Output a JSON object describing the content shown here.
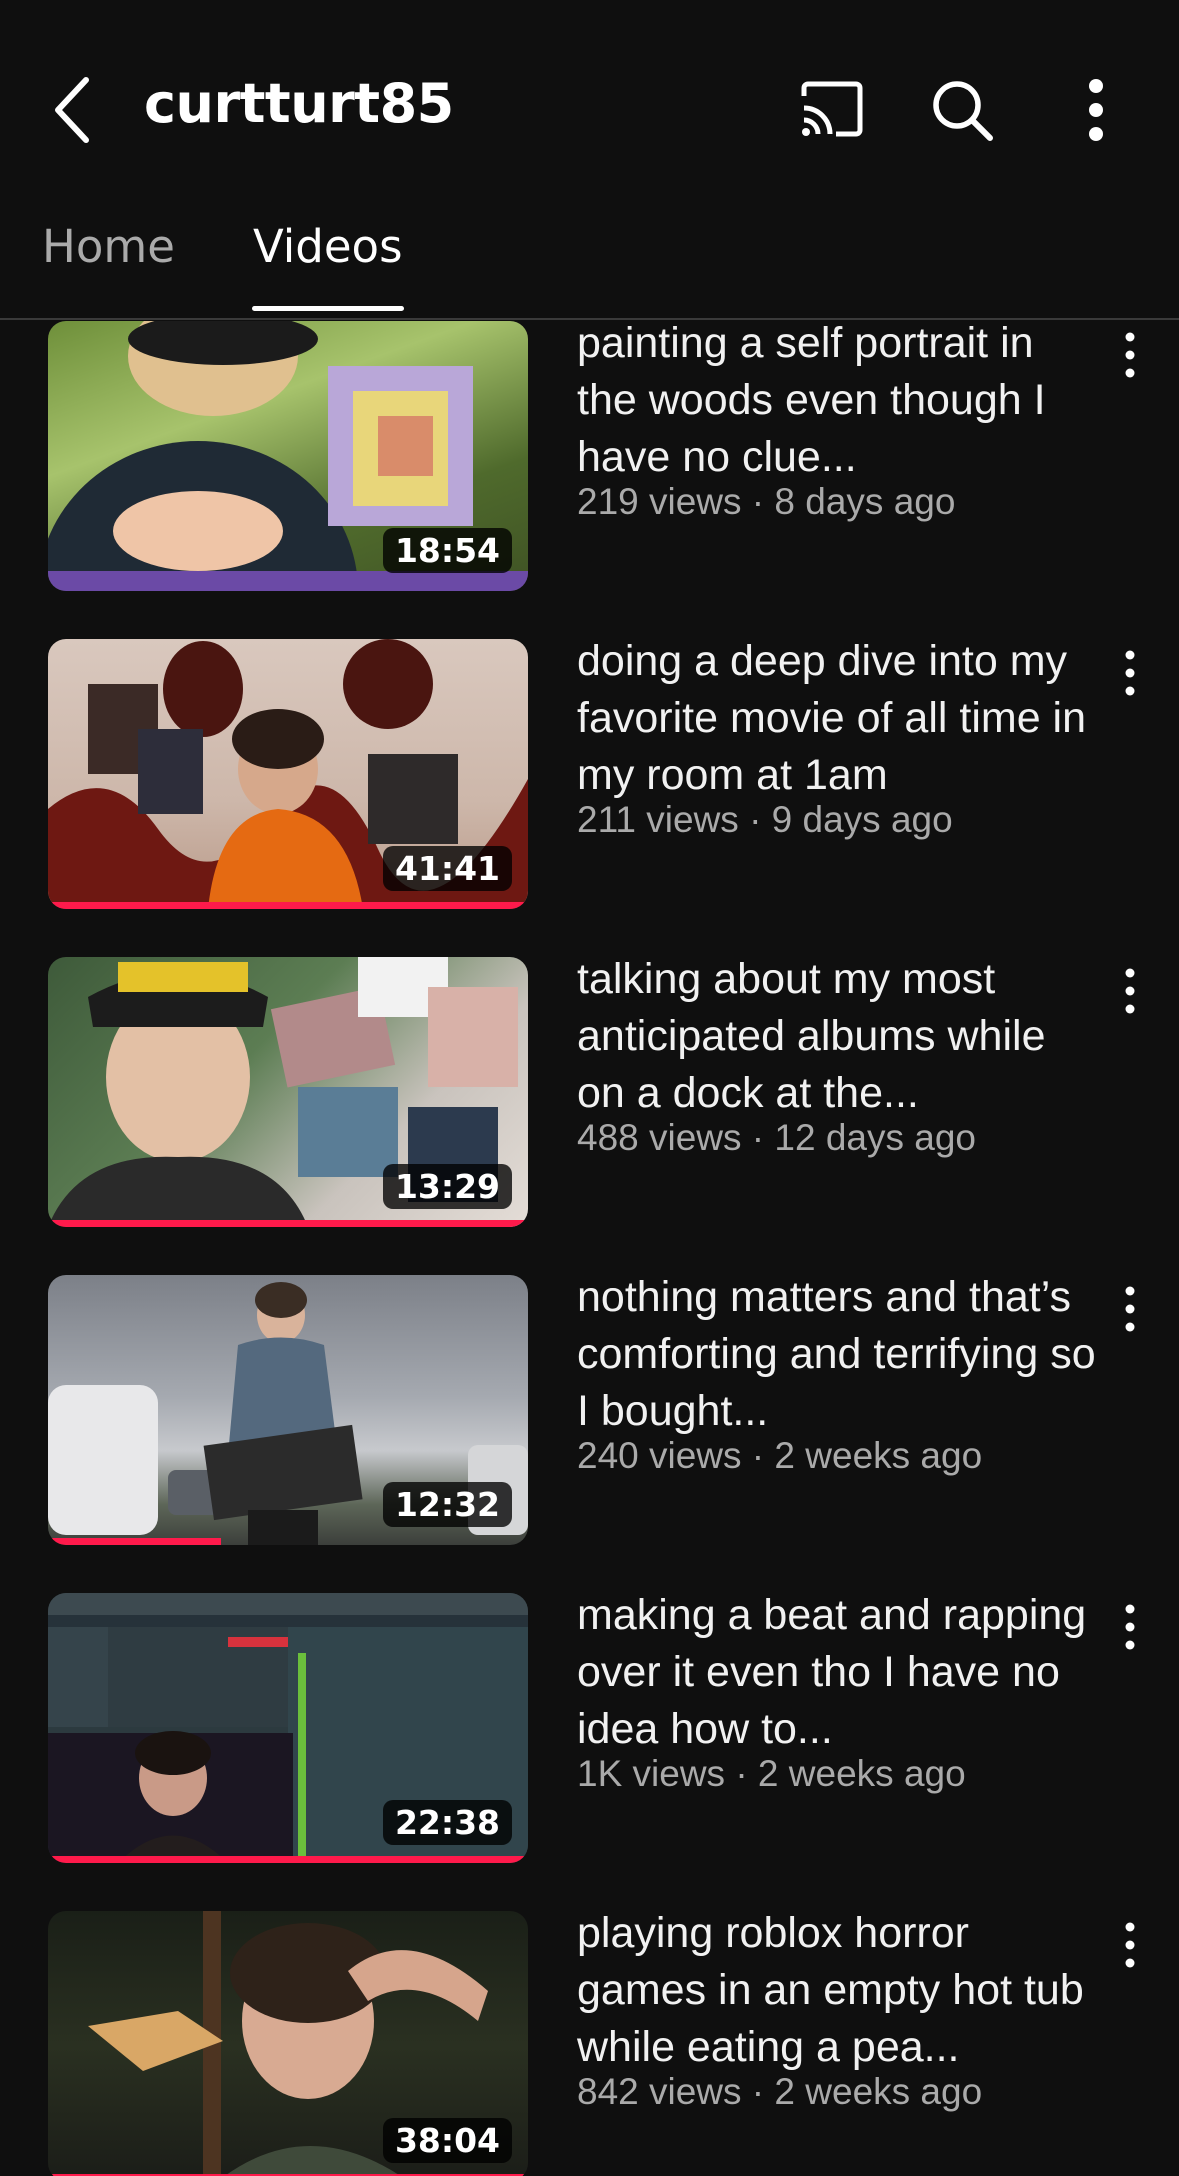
{
  "header": {
    "channel_name": "curtturt85",
    "icons": {
      "back": "chevron-left-icon",
      "cast": "cast-icon",
      "search": "search-icon",
      "more": "more-vertical-icon"
    }
  },
  "tabs": [
    {
      "label": "Home",
      "selected": false
    },
    {
      "label": "Videos",
      "selected": true
    }
  ],
  "colors": {
    "background": "#0f0f0f",
    "progress": "#ff1a4b",
    "meta_text": "#aaaaaa"
  },
  "videos": [
    {
      "title": "painting a self portrait in the woods even though I have no clue...",
      "meta": "219 views · 8 days ago",
      "duration": "18:54",
      "watched_fraction": 0
    },
    {
      "title": "doing a deep dive into my favorite movie of all time in my room at 1am",
      "meta": "211 views · 9 days ago",
      "duration": "41:41",
      "watched_fraction": 1.0
    },
    {
      "title": "talking about my most anticipated albums while on a dock at the...",
      "meta": "488 views · 12 days ago",
      "duration": "13:29",
      "watched_fraction": 1.0
    },
    {
      "title": "nothing matters and that’s comforting and terrifying so I bought...",
      "meta": "240 views · 2 weeks ago",
      "duration": "12:32",
      "watched_fraction": 0.36
    },
    {
      "title": "making a beat and rapping over it even tho I have no idea how to...",
      "meta": "1K views · 2 weeks ago",
      "duration": "22:38",
      "watched_fraction": 1.0
    },
    {
      "title": "playing roblox horror games in an empty hot tub while eating a pea...",
      "meta": "842 views · 2 weeks ago",
      "duration": "38:04",
      "watched_fraction": 1.0
    }
  ]
}
